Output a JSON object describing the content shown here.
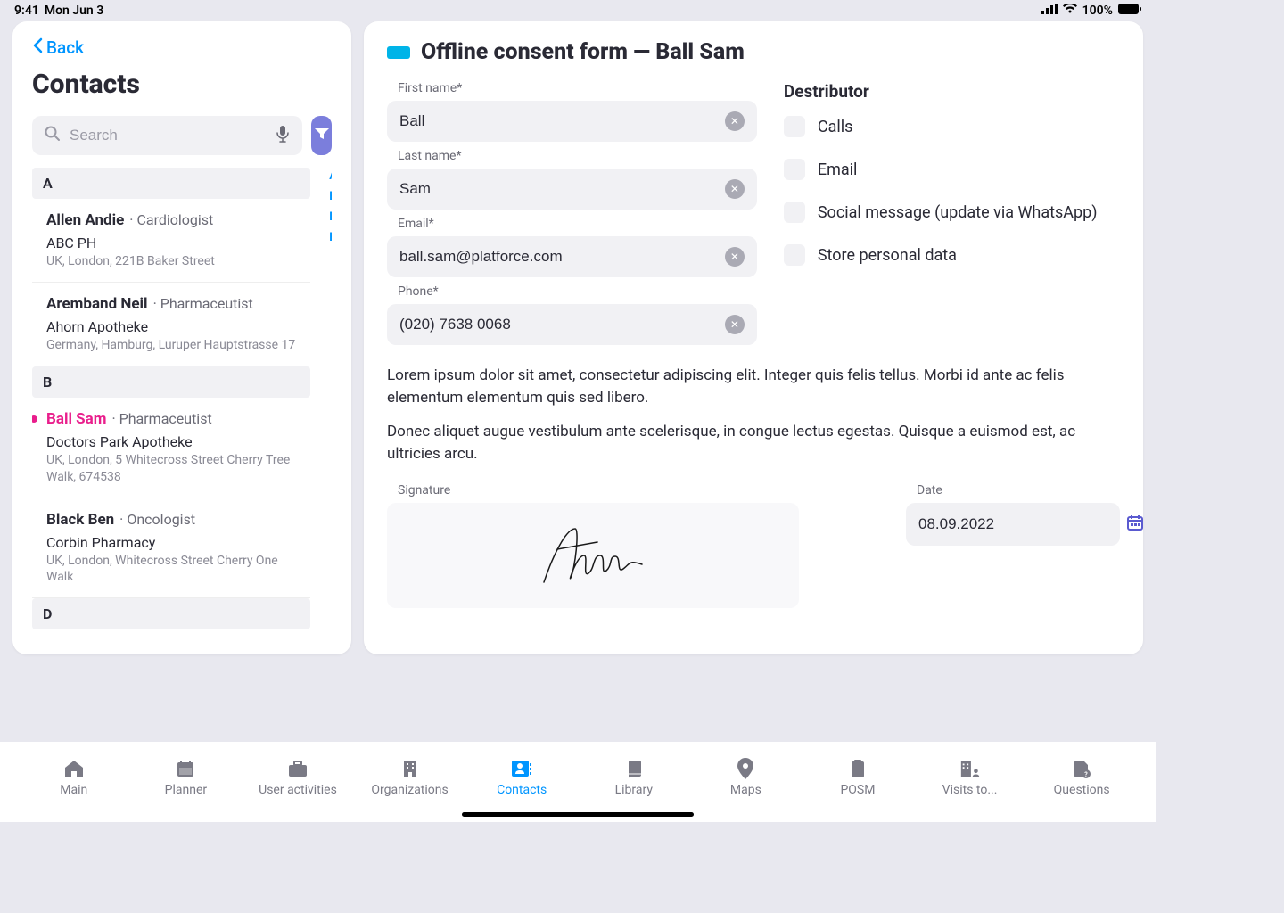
{
  "status": {
    "time": "9:41",
    "date": "Mon Jun 3",
    "battery": "100%"
  },
  "sidebar": {
    "back_label": "Back",
    "title": "Contacts",
    "search_placeholder": "Search",
    "alpha_index": [
      "A",
      "B",
      "D",
      "F"
    ],
    "sections": [
      {
        "letter": "A",
        "items": [
          {
            "name": "Allen Andie",
            "role": "Cardiologist",
            "org": "ABC PH",
            "addr": "UK, London, 221B Baker Street",
            "selected": false
          },
          {
            "name": "Aremband Neil",
            "role": "Pharmaceutist",
            "org": "Ahorn Apotheke",
            "addr": "Germany, Hamburg, Luruper Hauptstrasse 17",
            "selected": false
          }
        ]
      },
      {
        "letter": "B",
        "items": [
          {
            "name": "Ball Sam",
            "role": "Pharmaceutist",
            "org": "Doctors Park Apotheke",
            "addr": "UK, London, 5 Whitecross Street Cherry Tree Walk, 674538",
            "selected": true
          },
          {
            "name": "Black Ben",
            "role": "Oncologist",
            "org": "Corbin Pharmacy",
            "addr": "UK, London, Whitecross Street Cherry One Walk",
            "selected": false
          }
        ]
      },
      {
        "letter": "D",
        "items": []
      }
    ]
  },
  "form": {
    "title": "Offline consent form — Ball Sam",
    "fields": {
      "first_name_label": "First name*",
      "first_name_value": "Ball",
      "last_name_label": "Last name*",
      "last_name_value": "Sam",
      "email_label": "Email*",
      "email_value": "ball.sam@platforce.com",
      "phone_label": "Phone*",
      "phone_value": "(020) 7638 0068"
    },
    "distributor": {
      "title": "Destributor",
      "options": [
        "Calls",
        "Email",
        "Social message (update via WhatsApp)",
        "Store personal data"
      ]
    },
    "paragraph1": "Lorem ipsum dolor sit amet, consectetur adipiscing elit. Integer quis felis tellus. Morbi id ante ac felis elementum elementum quis sed libero.",
    "paragraph2": "Donec aliquet augue vestibulum ante scelerisque, in congue lectus egestas. Quisque a euismod est, ac ultricies arcu.",
    "signature_label": "Signature",
    "date_label": "Date",
    "date_value": "08.09.2022"
  },
  "nav": {
    "items": [
      "Main",
      "Planner",
      "User activities",
      "Organizations",
      "Contacts",
      "Library",
      "Maps",
      "POSM",
      "Visits to...",
      "Questions"
    ],
    "active_index": 4
  }
}
